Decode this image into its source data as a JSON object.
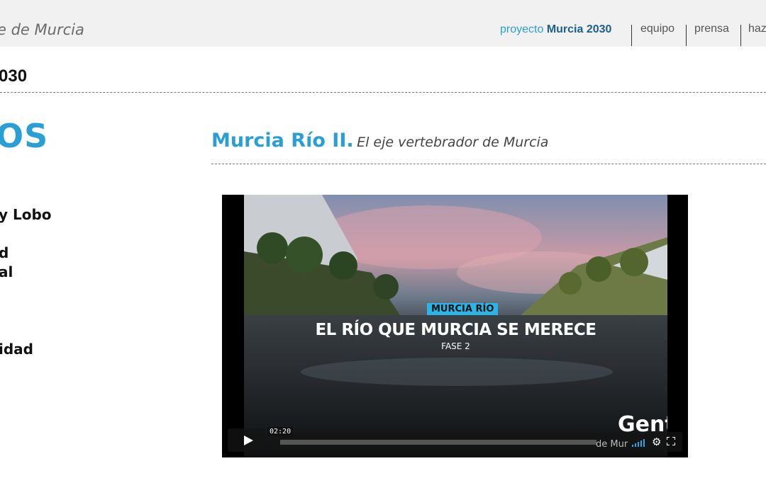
{
  "header": {
    "site_tagline": "e de Murcia",
    "nav": {
      "proyecto_prefix": "proyecto",
      "proyecto_name": "Murcia 2030",
      "equipo": "equipo",
      "prensa": "prensa",
      "haz": "haz"
    }
  },
  "subheader": {
    "title": "030"
  },
  "sidebar": {
    "heading": "OS",
    "items": [
      "y Lobo",
      "d",
      "al",
      "idad"
    ]
  },
  "article": {
    "title_bold": "Murcia Río II.",
    "title_italic": "El eje vertebrador de Murcia"
  },
  "video": {
    "badge": "MURCIA RÍO",
    "headline": "EL RÍO QUE MURCIA SE MERECE",
    "subline": "FASE 2",
    "timecode": "02:20",
    "progress": 0.0,
    "watermark": "Gente",
    "watermark_sub": "de Mur",
    "icons": [
      "play-icon",
      "volume-icon",
      "settings-icon",
      "fullscreen-icon"
    ]
  },
  "colors": {
    "accent": "#2a9fd6",
    "accent_dark": "#1a5f8f",
    "topbar": "#f1f1f1"
  }
}
